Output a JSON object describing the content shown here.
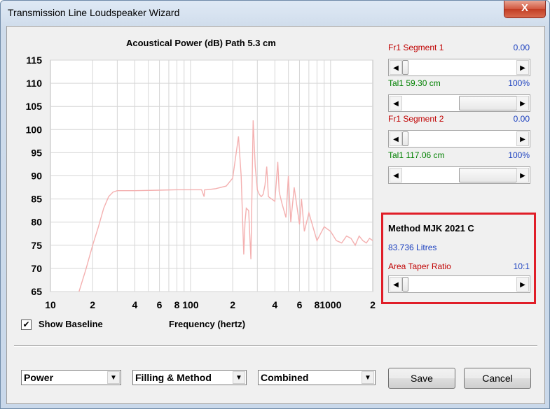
{
  "window": {
    "title": "Transmission Line Loudspeaker Wizard",
    "close_glyph": "X"
  },
  "chart_title": "Acoustical Power (dB)   Path 5.3 cm",
  "chart_data": {
    "type": "line",
    "title": "Acoustical Power (dB)   Path 5.3 cm",
    "xlabel": "Frequency (hertz)",
    "ylabel": "",
    "x_scale": "log",
    "xlim": [
      10,
      2000
    ],
    "ylim": [
      65,
      115
    ],
    "y_ticks": [
      "115",
      "110",
      "105",
      "100",
      "95",
      "90",
      "85",
      "80",
      "75",
      "70",
      "65"
    ],
    "x_ticks": [
      "10",
      "2",
      "4",
      "6",
      "8",
      "100",
      "2",
      "4",
      "6",
      "8",
      "1000",
      "2"
    ],
    "grid": true,
    "series": [
      {
        "color": "#f4b0b0",
        "x": [
          16,
          18,
          20,
          22,
          24,
          26,
          28,
          30,
          40,
          60,
          80,
          100,
          120,
          125,
          126,
          130,
          150,
          180,
          200,
          220,
          230,
          240,
          245,
          250,
          260,
          270,
          280,
          290,
          300,
          310,
          320,
          330,
          340,
          350,
          360,
          400,
          420,
          430,
          450,
          480,
          500,
          520,
          550,
          600,
          620,
          650,
          700,
          800,
          900,
          1000,
          1100,
          1200,
          1300,
          1400,
          1500,
          1600,
          1700,
          1800,
          1900,
          2000
        ],
        "y": [
          65,
          70,
          75,
          79,
          83,
          85.5,
          86.5,
          86.8,
          86.8,
          86.9,
          87,
          87,
          87,
          85.5,
          87,
          87,
          87.2,
          87.8,
          89.5,
          98.5,
          90,
          73,
          80,
          83,
          82.5,
          72,
          102,
          92,
          87,
          86,
          85.5,
          86,
          88,
          92,
          85.5,
          84.5,
          93,
          86.5,
          84,
          81,
          90,
          80,
          87.5,
          79.5,
          85,
          78,
          82,
          76,
          79,
          78,
          76,
          75.5,
          77,
          76.5,
          75,
          77,
          76,
          75.5,
          76.5,
          76
        ]
      }
    ]
  },
  "right_panel": {
    "rows": [
      {
        "label": "Fr1  Segment 1",
        "value": "0.00",
        "thumb": 0.0,
        "color": "red"
      },
      {
        "label": "Tal1  59.30 cm",
        "value": "100%",
        "thumb": 0.5,
        "color": "green"
      },
      {
        "label": "Fr1  Segment 2",
        "value": "0.00",
        "thumb": 0.0,
        "color": "red"
      },
      {
        "label": "Tal1  117.06 cm",
        "value": "100%",
        "thumb": 0.5,
        "color": "green"
      }
    ],
    "method_title": "Method MJK 2021 C",
    "litres": "83.736 Litres",
    "taper_label": "Area Taper Ratio",
    "taper_value": "10:1",
    "taper_thumb": 0.0
  },
  "show_baseline": {
    "label": "Show Baseline",
    "checked": true
  },
  "frequency_label": "Frequency (hertz)",
  "dropdowns": {
    "power": "Power",
    "filling": "Filling & Method",
    "combined": "Combined"
  },
  "buttons": {
    "save": "Save",
    "cancel": "Cancel"
  }
}
